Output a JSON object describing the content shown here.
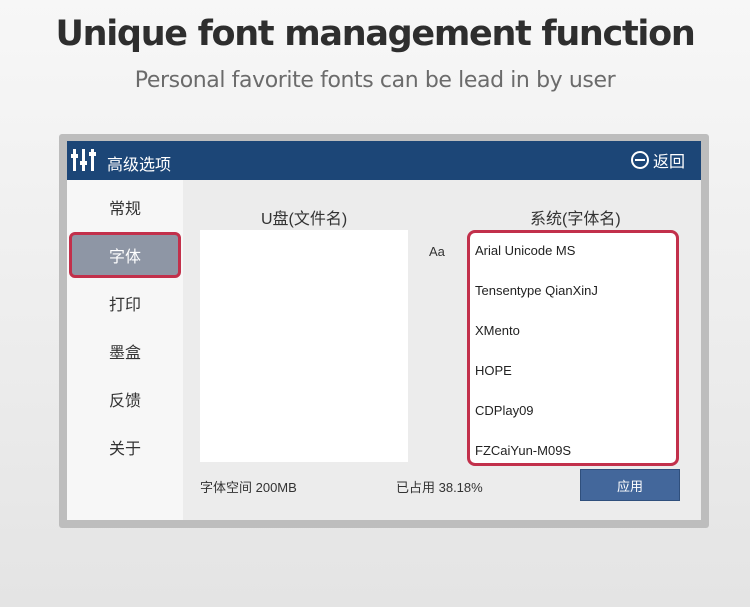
{
  "headline": "Unique font management function",
  "subheadline": "Personal favorite fonts can be lead in by user",
  "titlebar": {
    "title": "高级选项",
    "back_label": "返回"
  },
  "sidebar": {
    "items": [
      {
        "label": "常规",
        "active": false
      },
      {
        "label": "字体",
        "active": true
      },
      {
        "label": "打印",
        "active": false
      },
      {
        "label": "墨盒",
        "active": false
      },
      {
        "label": "反馈",
        "active": false
      },
      {
        "label": "关于",
        "active": false
      }
    ]
  },
  "main": {
    "usb_title": "U盘(文件名)",
    "system_title": "系统(字体名)",
    "aa_label": "Aa",
    "system_fonts": [
      "Arial Unicode MS",
      "Tensentype QianXinJ",
      "XMento",
      "HOPE",
      "CDPlay09",
      "FZCaiYun-M09S"
    ],
    "font_space": "字体空间 200MB",
    "used": "已占用 38.18%",
    "apply_label": "应用"
  },
  "colors": {
    "titlebar": "#1c4677",
    "highlight_border": "#c2304b",
    "action_button": "#4d6d98",
    "apply_button": "#43679b",
    "active_tab": "#8e96a5"
  },
  "icons": {
    "titlebar": "settings-sliders-icon",
    "back": "back-arrow-circle-icon",
    "import": "folder-import-icon",
    "refresh": "refresh-icon",
    "delete": "trash-icon"
  }
}
